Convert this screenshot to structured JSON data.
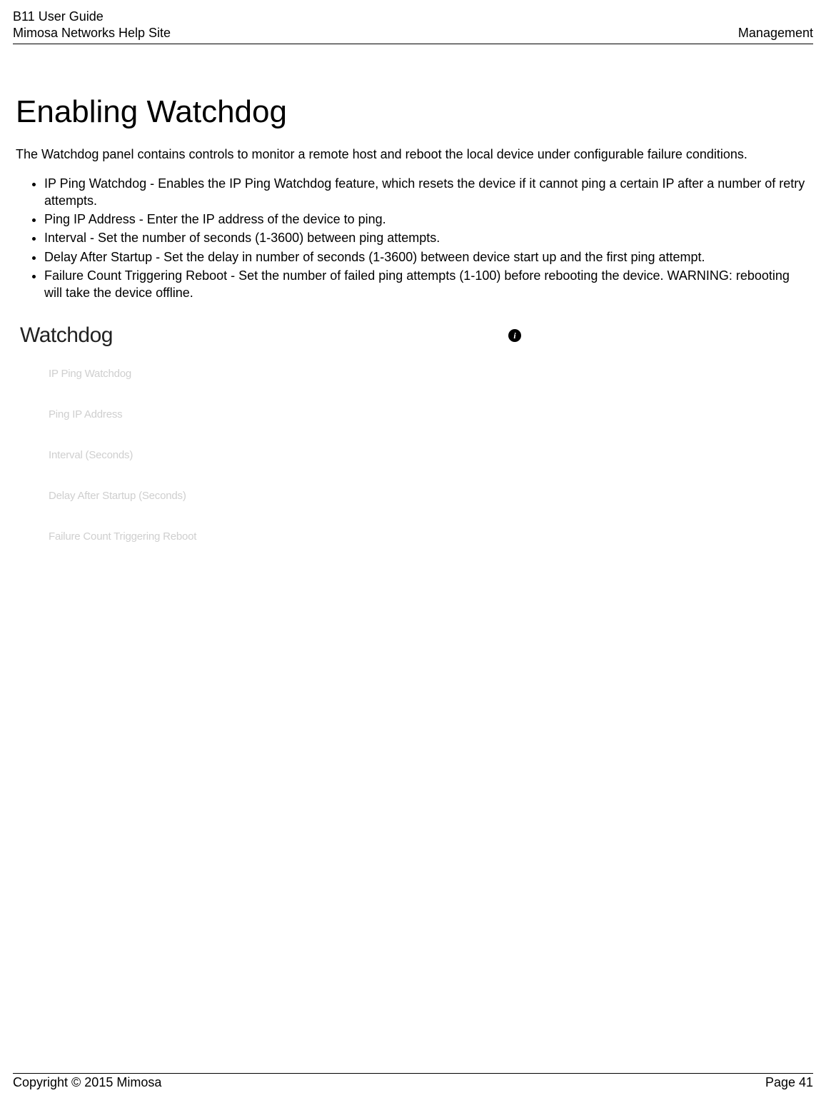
{
  "header": {
    "guide_title": "B11 User Guide",
    "site_name": "Mimosa Networks Help Site",
    "section": "Management"
  },
  "page": {
    "title": "Enabling Watchdog",
    "intro": "The Watchdog panel contains controls to monitor a remote host and reboot the local device under configurable failure conditions.",
    "bullets": [
      "IP Ping Watchdog - Enables the IP Ping Watchdog feature, which resets the device if it cannot ping a certain IP after a number of retry attempts.",
      "Ping IP Address - Enter the IP address of the device to ping.",
      "Interval - Set the number of seconds (1-3600) between ping attempts.",
      "Delay After Startup - Set the delay in number of seconds (1-3600) between device start up and the first ping attempt.",
      "Failure Count Triggering Reboot - Set the number of failed ping attempts (1-100) before rebooting the device. WARNING: rebooting will take the device offline."
    ]
  },
  "panel": {
    "title": "Watchdog",
    "info_icon_glyph": "i",
    "fields": [
      "IP Ping Watchdog",
      "Ping IP Address",
      "Interval (Seconds)",
      "Delay After Startup (Seconds)",
      "Failure Count Triggering Reboot"
    ]
  },
  "footer": {
    "copyright": "Copyright © 2015 Mimosa",
    "page_label": "Page 41"
  }
}
